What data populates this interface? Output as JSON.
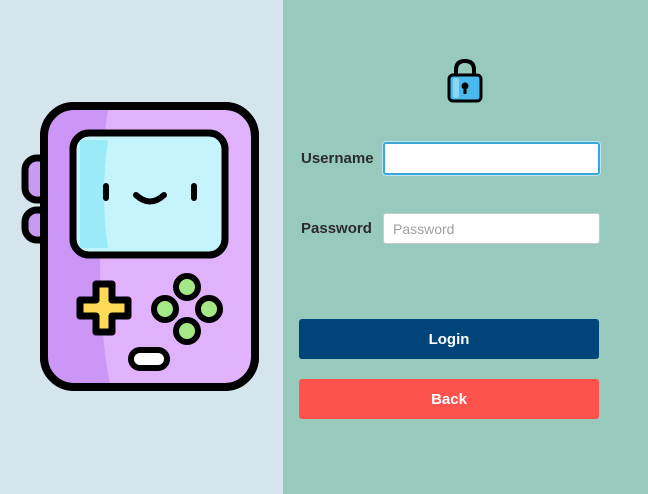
{
  "form": {
    "username_label": "Username",
    "username_value": "",
    "username_placeholder": "",
    "password_label": "Password",
    "password_placeholder": "Password",
    "login_label": "Login",
    "back_label": "Back"
  },
  "icons": {
    "illustration": "handheld-game-console-icon",
    "lock": "lock-icon"
  },
  "colors": {
    "left_bg": "#d5e5ec",
    "right_bg": "#98c9bd",
    "login_bg": "#00457a",
    "back_bg": "#fe524d"
  }
}
